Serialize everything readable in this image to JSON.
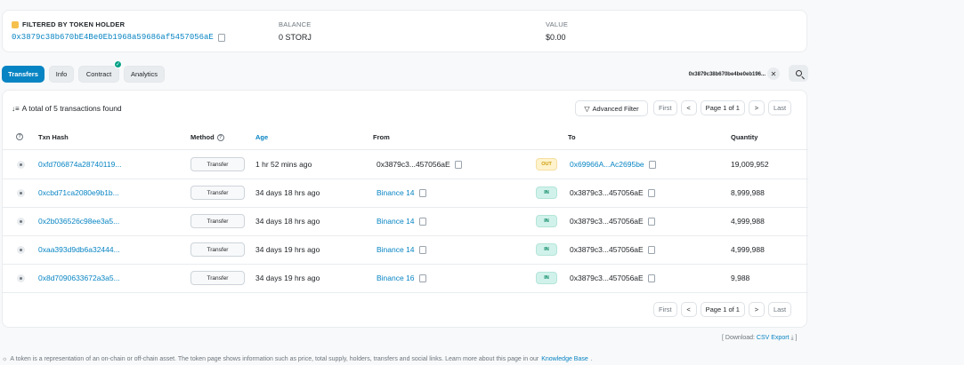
{
  "filter": {
    "label": "FILTERED BY TOKEN HOLDER",
    "address": "0x3879c38b670bE4Be0Eb1968a59686af5457056aE",
    "balance_label": "BALANCE",
    "balance_value": "0 STORJ",
    "value_label": "VALUE",
    "value_value": "$0.00"
  },
  "tabs": [
    {
      "label": "Transfers",
      "active": true
    },
    {
      "label": "Info",
      "active": false
    },
    {
      "label": "Contract",
      "active": false
    },
    {
      "label": "Analytics",
      "active": false
    }
  ],
  "search": {
    "address_chip": "0x3879c38b670be4be0eb196...",
    "clear_glyph": "✕"
  },
  "summary": "A total of 5 transactions found",
  "advanced_filter_label": "Advanced Filter",
  "pager": {
    "first": "First",
    "info": "Page 1 of 1",
    "last": "Last"
  },
  "columns": {
    "hash": "Txn Hash",
    "method": "Method",
    "age": "Age",
    "from": "From",
    "to": "To",
    "quantity": "Quantity"
  },
  "rows": [
    {
      "hash": "0xfd706874a28740119...",
      "method": "Transfer",
      "age": "1 hr 52 mins ago",
      "from": "0x3879c3...457056aE",
      "from_link": false,
      "dir": "OUT",
      "to": "0x69966A...Ac2695be",
      "to_link": true,
      "qty": "19,009,952"
    },
    {
      "hash": "0xcbd71ca2080e9b1b...",
      "method": "Transfer",
      "age": "34 days 18 hrs ago",
      "from": "Binance 14",
      "from_link": true,
      "dir": "IN",
      "to": "0x3879c3...457056aE",
      "to_link": false,
      "qty": "8,999,988"
    },
    {
      "hash": "0x2b036526c98ee3a5...",
      "method": "Transfer",
      "age": "34 days 18 hrs ago",
      "from": "Binance 14",
      "from_link": true,
      "dir": "IN",
      "to": "0x3879c3...457056aE",
      "to_link": false,
      "qty": "4,999,988"
    },
    {
      "hash": "0xaa393d9db6a32444...",
      "method": "Transfer",
      "age": "34 days 19 hrs ago",
      "from": "Binance 14",
      "from_link": true,
      "dir": "IN",
      "to": "0x3879c3...457056aE",
      "to_link": false,
      "qty": "4,999,988"
    },
    {
      "hash": "0x8d7090633672a3a5...",
      "method": "Transfer",
      "age": "34 days 19 hrs ago",
      "from": "Binance 16",
      "from_link": true,
      "dir": "IN",
      "to": "0x3879c3...457056aE",
      "to_link": false,
      "qty": "9,988"
    }
  ],
  "download": {
    "prefix": "[ Download:",
    "link": "CSV Export",
    "suffix": "]"
  },
  "footnote": {
    "text": "A token is a representation of an on-chain or off-chain asset. The token page shows information such as price, total supply, holders, transfers and social links. Learn more about this page in our",
    "link": "Knowledge Base",
    "end": "."
  },
  "colors": {
    "accent": "#0784c3",
    "out": "#cc9a06",
    "in": "#00845e"
  }
}
